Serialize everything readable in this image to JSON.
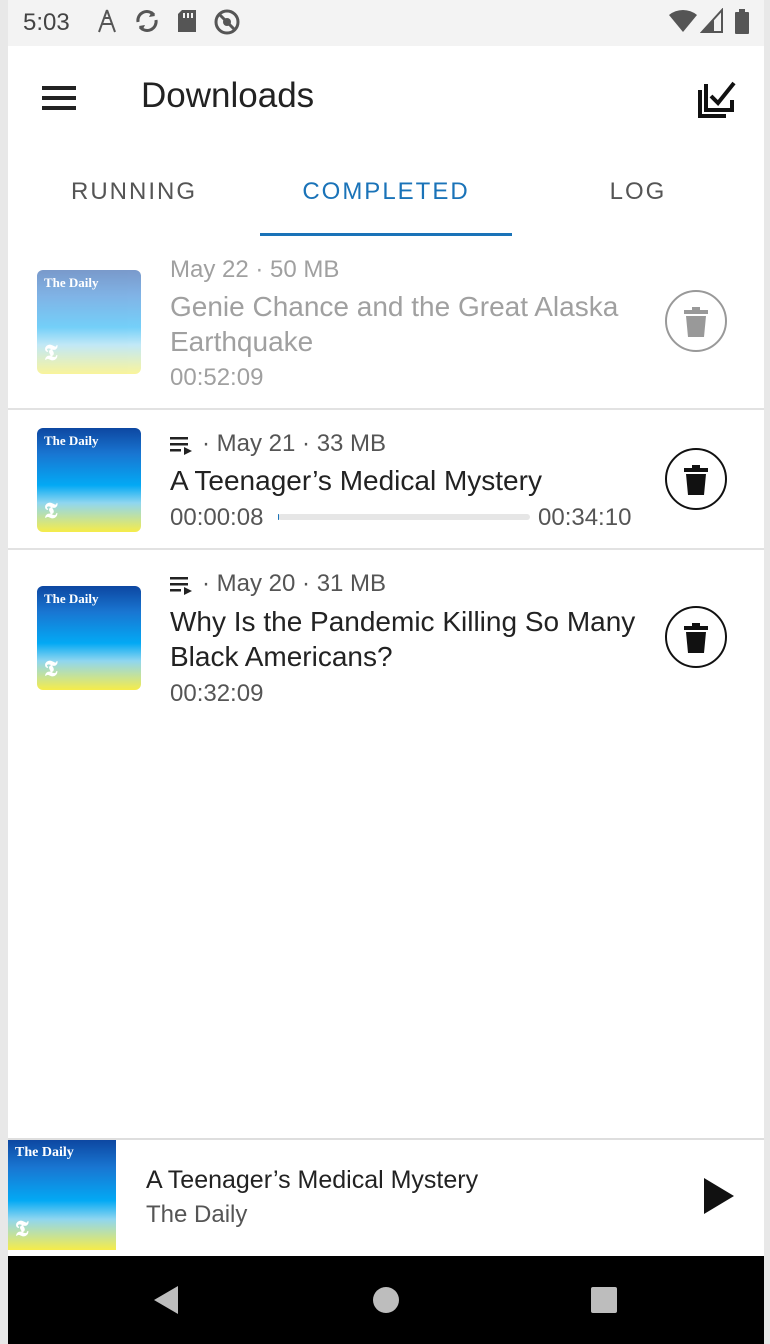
{
  "status_bar": {
    "time": "5:03"
  },
  "app_bar": {
    "title": "Downloads"
  },
  "tabs": [
    {
      "label": "RUNNING",
      "active": false
    },
    {
      "label": "COMPLETED",
      "active": true
    },
    {
      "label": "LOG",
      "active": false
    }
  ],
  "episodes": [
    {
      "meta": "May 22 · 50 MB",
      "title": "Genie Chance and the Great Alaska Earthquake",
      "duration": "00:52:09",
      "played": true,
      "cover_text": "The Daily"
    },
    {
      "meta": "· May 21 · 33 MB",
      "title": "A Teenager’s Medical Mystery",
      "position": "00:00:08",
      "duration": "00:34:10",
      "progress": 0.004,
      "in_queue": true,
      "cover_text": "The Daily"
    },
    {
      "meta": "· May 20 · 31 MB",
      "title": "Why Is the Pandemic Killing So Many Black Americans?",
      "duration": "00:32:09",
      "in_queue": true,
      "cover_text": "The Daily"
    }
  ],
  "player": {
    "title": "A Teenager’s Medical Mystery",
    "podcast": "The Daily",
    "cover_text": "The Daily"
  },
  "icons": {
    "menu": "hamburger-menu-icon",
    "select_all": "checkbox-select-icon",
    "delete": "trash-icon",
    "queue": "queue-icon",
    "play": "play-icon"
  },
  "colors": {
    "accent": "#1a73b8",
    "text": "#222222",
    "secondary": "#555555"
  }
}
